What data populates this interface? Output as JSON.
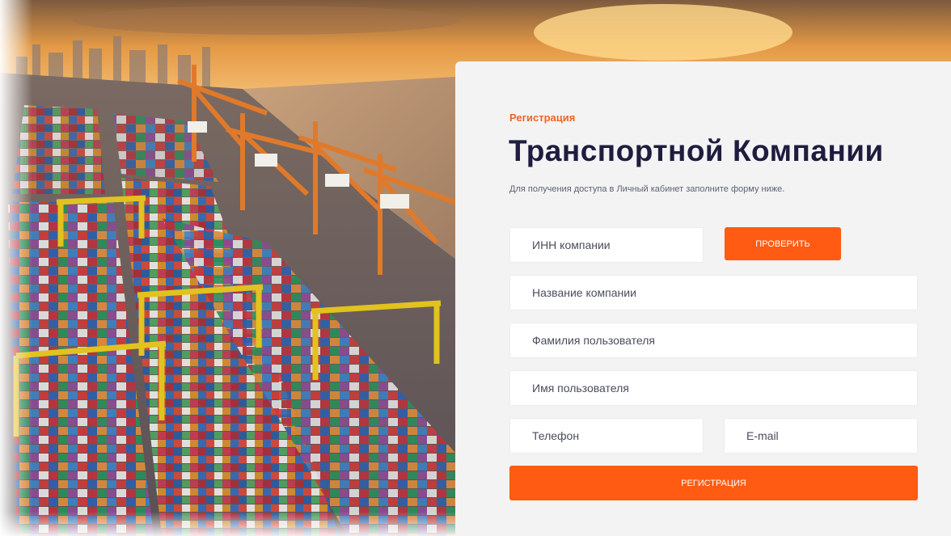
{
  "registration": {
    "eyebrow": "Регистрация",
    "title": "Транспортной Компании",
    "subtitle": "Для получения доступа в Личный кабинет заполните форму ниже.",
    "fields": {
      "inn_placeholder": "ИНН компании",
      "company_placeholder": "Название компании",
      "lastname_placeholder": "Фамилия пользователя",
      "firstname_placeholder": "Имя пользователя",
      "phone_placeholder": "Телефон",
      "email_placeholder": "E-mail"
    },
    "check_button": "ПРОВЕРИТЬ",
    "submit_button": "РЕГИСТРАЦИЯ"
  },
  "colors": {
    "accent": "#ff5b12",
    "eyebrow": "#f26522",
    "title": "#1e1d3f",
    "panel_bg": "#f3f3f4"
  }
}
